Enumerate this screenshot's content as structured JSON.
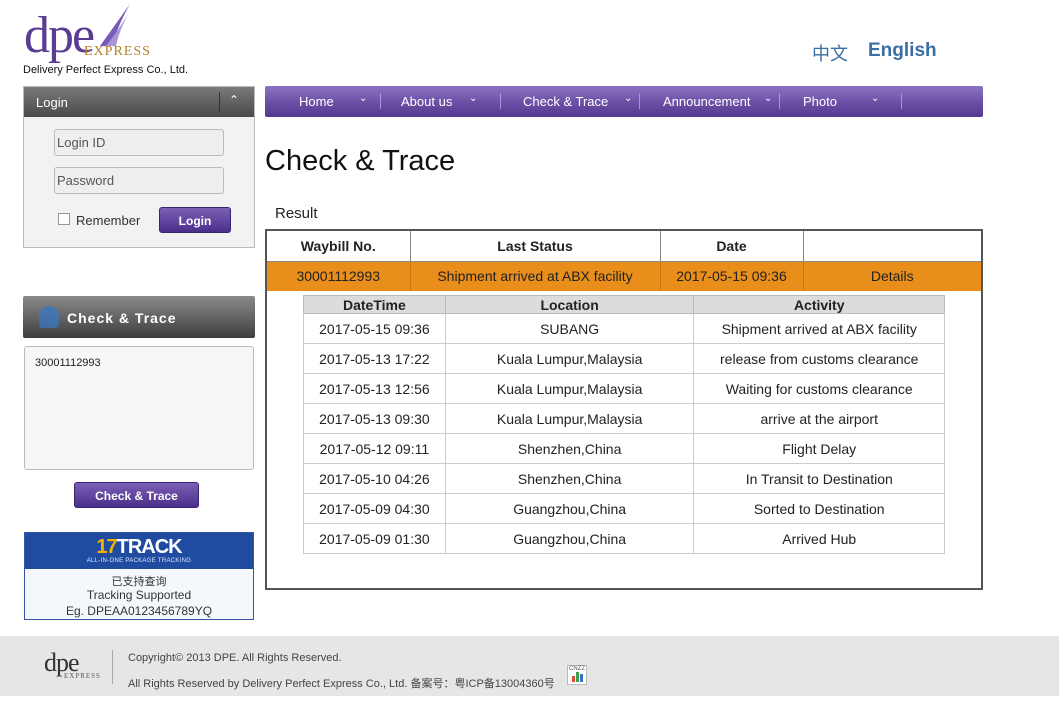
{
  "header": {
    "logo_text": "dpe",
    "logo_express": "EXPRESS",
    "company": "Delivery Perfect  Express Co., Ltd.",
    "lang_cn": "中文",
    "lang_en": "English"
  },
  "login": {
    "title": "Login",
    "login_id_placeholder": "Login ID",
    "password_placeholder": "Password",
    "remember_label": "Remember",
    "button": "Login"
  },
  "nav": {
    "items": [
      "Home",
      "About us",
      "Check & Trace",
      "Announcement",
      "Photo"
    ]
  },
  "left_trace": {
    "title": "Check & Trace",
    "textarea_value": "30001112993",
    "button": "Check & Trace"
  },
  "track_banner": {
    "logo_num": "17",
    "logo_word": "TRACK",
    "tagline": "ALL-IN-ONE PACKAGE TRACKING",
    "line1": "已支持查询",
    "line2": "Tracking Supported",
    "line3": "Eg. DPEAA0123456789YQ"
  },
  "main": {
    "title": "Check & Trace",
    "result_label": "Result",
    "result_headers": [
      "Waybill No.",
      "Last Status",
      "Date",
      ""
    ],
    "result_row": {
      "waybill": "30001112993",
      "last_status": "Shipment arrived at ABX facility",
      "date": "2017-05-15 09:36",
      "details": "Details"
    },
    "detail_headers": [
      "DateTime",
      "Location",
      "Activity"
    ],
    "detail_rows": [
      [
        "2017-05-15 09:36",
        "SUBANG",
        "Shipment arrived at ABX facility"
      ],
      [
        "2017-05-13 17:22",
        "Kuala Lumpur,Malaysia",
        "release from customs clearance"
      ],
      [
        "2017-05-13 12:56",
        "Kuala Lumpur,Malaysia",
        "Waiting for customs clearance"
      ],
      [
        "2017-05-13 09:30",
        "Kuala Lumpur,Malaysia",
        "arrive at the airport"
      ],
      [
        "2017-05-12 09:11",
        "Shenzhen,China",
        "Flight Delay"
      ],
      [
        "2017-05-10 04:26",
        "Shenzhen,China",
        "In Transit to Destination"
      ],
      [
        "2017-05-09 04:30",
        "Guangzhou,China",
        "Sorted to Destination"
      ],
      [
        "2017-05-09 01:30",
        "Guangzhou,China",
        "Arrived Hub"
      ]
    ]
  },
  "footer": {
    "logo_text": "dpe",
    "logo_express": "EXPRESS",
    "copyright": "Copyright© 2013 DPE. All Rights Reserved.",
    "rights": "All Rights Reserved by Delivery Perfect Express Co., Ltd. 备案号：粤ICP备13004360号",
    "counter_label": "CNZZ"
  },
  "colors": {
    "brand_purple": "#6a4fa6",
    "highlight_orange": "#e98e1a",
    "link_blue": "#3a6ea5"
  }
}
